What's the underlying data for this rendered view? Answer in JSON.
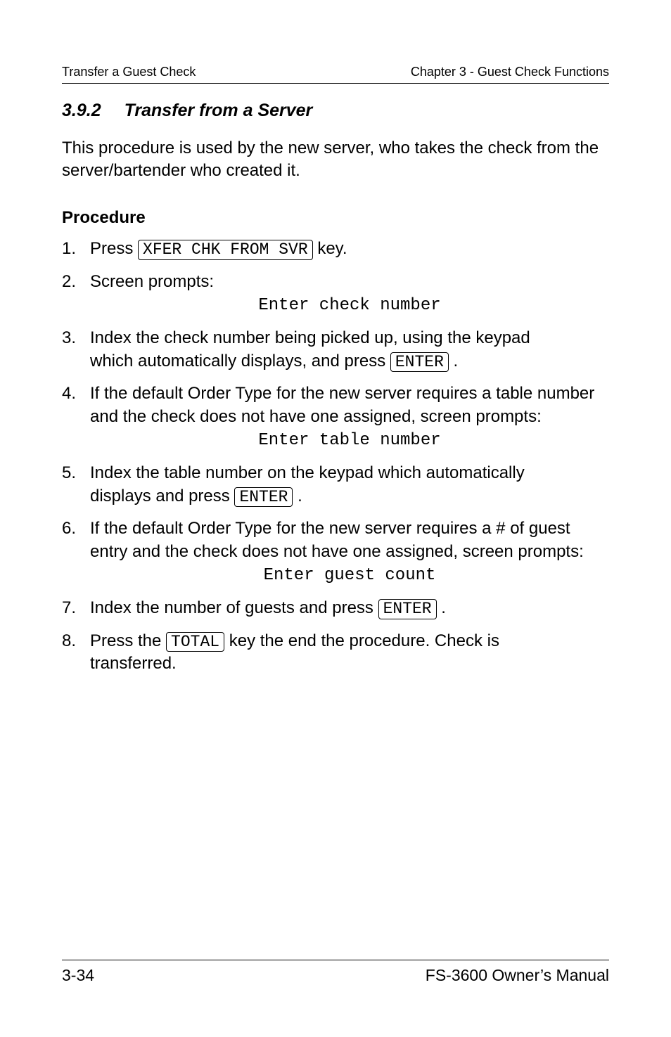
{
  "header": {
    "left": "Transfer a Guest Check",
    "right": "Chapter 3 - Guest Check Functions"
  },
  "section": {
    "number": "3.9.2",
    "title": "Transfer from a Server"
  },
  "intro": "This procedure is used by the new server, who takes the check from the server/bartender who created it.",
  "procedure_heading": "Procedure",
  "steps": {
    "s1": {
      "pre": "Press ",
      "key": "XFER CHK FROM SVR",
      "post": " key."
    },
    "s2": {
      "text": "Screen prompts:",
      "prompt": "Enter check number"
    },
    "s3": {
      "line1": "Index the check number being picked up, using the keypad",
      "line2a": "which automatically displays, and press ",
      "key": "ENTER",
      "line2b": " ."
    },
    "s4": {
      "text": "If the default Order Type for the new server requires a table number and the check does not have one assigned, screen prompts:",
      "prompt": "Enter table number"
    },
    "s5": {
      "line1": "Index the table number on the keypad which automatically",
      "line2a": "displays and press ",
      "key": "ENTER",
      "line2b": " ."
    },
    "s6": {
      "text": "If the default Order Type for the new server requires a # of guest entry and the check does not have one assigned, screen prompts:",
      "prompt": "Enter guest count"
    },
    "s7": {
      "pre": "Index the number of guests and press ",
      "key": "ENTER",
      "post": " ."
    },
    "s8": {
      "pre": "Press the ",
      "key": "TOTAL",
      "mid": " key the end the procedure.  Check is",
      "line2": "transferred."
    }
  },
  "footer": {
    "left": "3-34",
    "right": "FS-3600 Owner’s Manual"
  }
}
